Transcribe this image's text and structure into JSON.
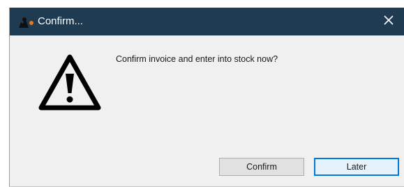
{
  "dialog": {
    "title": "Confirm...",
    "message": "Confirm invoice and enter into stock now?",
    "icons": {
      "app": "app-logo-icon",
      "close": "close-icon",
      "warning": "warning-triangle-icon"
    },
    "buttons": {
      "confirm_label": "Confirm",
      "later_label": "Later"
    }
  },
  "colors": {
    "titlebar": "#1f3b52",
    "dialog_background": "#f0f0f0",
    "default_button_border": "#0078d7",
    "app_icon_accent": "#e8761e"
  }
}
